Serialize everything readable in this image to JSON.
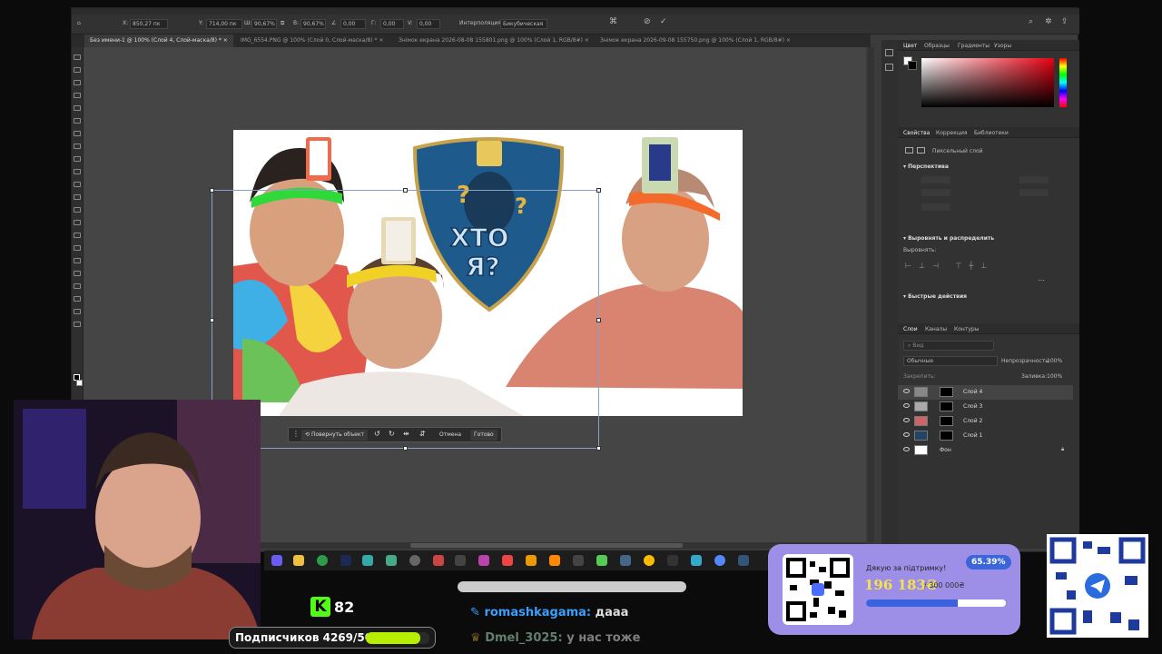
{
  "optionsbar": {
    "x_label": "X:",
    "x_value": "850,27 пк",
    "y_label": "Y:",
    "y_value": "714,00 пк",
    "w_label": "Ш:",
    "w_value": "90,67%",
    "h_label": "В:",
    "h_value": "90,67%",
    "angle_value": "0,00",
    "hskew_label": "Г:",
    "hskew_value": "0,00",
    "vskew_label": "V:",
    "vskew_value": "0,00",
    "interp_label": "Интерполяция:",
    "interp_value": "Бикубическая"
  },
  "tabs": [
    {
      "label": "Без имени-1 @ 100% (Слой 4, Слой-маска/8) *"
    },
    {
      "label": "IMG_6554.PNG @ 100% (Слой 0, Слой-маска/8) *"
    },
    {
      "label": "Знімок екрана 2026-08-08 155801.png @ 100% (Слой 1, RGB/8#)"
    },
    {
      "label": "Знімок екрана 2026-09-08 155750.png @ 100% (Слой 1, RGB/8#)"
    }
  ],
  "artwork": {
    "logo_line1": "ХТО",
    "logo_line2": "Я?"
  },
  "contextbar": {
    "rotate": "Повернуть объект",
    "cancel": "Отмена",
    "done": "Готово"
  },
  "panels": {
    "color_tabs": [
      "Цвет",
      "Образцы",
      "Градиенты",
      "Узоры"
    ],
    "prop_tabs": [
      "Свойства",
      "Коррекция",
      "Библиотеки"
    ],
    "pixel_layer": "Пиксельный слой",
    "perspective": "Перспектива",
    "align_section": "Выровнять и распределить",
    "align_label": "Выровнять:",
    "quick_actions": "Быстрые действия",
    "layer_tabs": [
      "Слои",
      "Каналы",
      "Контуры"
    ],
    "search_placeholder": "Вид",
    "blend_mode": "Обычные",
    "opacity_label": "Непрозрачность:",
    "opacity_value": "100%",
    "lock_label": "Закрепить:",
    "fill_label": "Заливка:",
    "fill_value": "100%",
    "layers": [
      {
        "name": "Слой 4",
        "selected": true
      },
      {
        "name": "Слой 3",
        "selected": false
      },
      {
        "name": "Слой 2",
        "selected": false
      },
      {
        "name": "Слой 1",
        "selected": false
      },
      {
        "name": "Фон",
        "selected": false
      }
    ]
  },
  "stream": {
    "kick_count": "82",
    "subscribers": "Подписчиков 4269/5000",
    "subscriber_progress": 0.8538,
    "chat": [
      {
        "user": "romashkagama",
        "message": "дааа"
      },
      {
        "user": "Dmel_3025",
        "message": "у нас тоже"
      }
    ],
    "donation": {
      "title": "Дякую за підтримку!",
      "percent": "65.39%",
      "raised": "196 183₴",
      "goal": "/ 300 000₴",
      "progress": 0.6539
    }
  }
}
